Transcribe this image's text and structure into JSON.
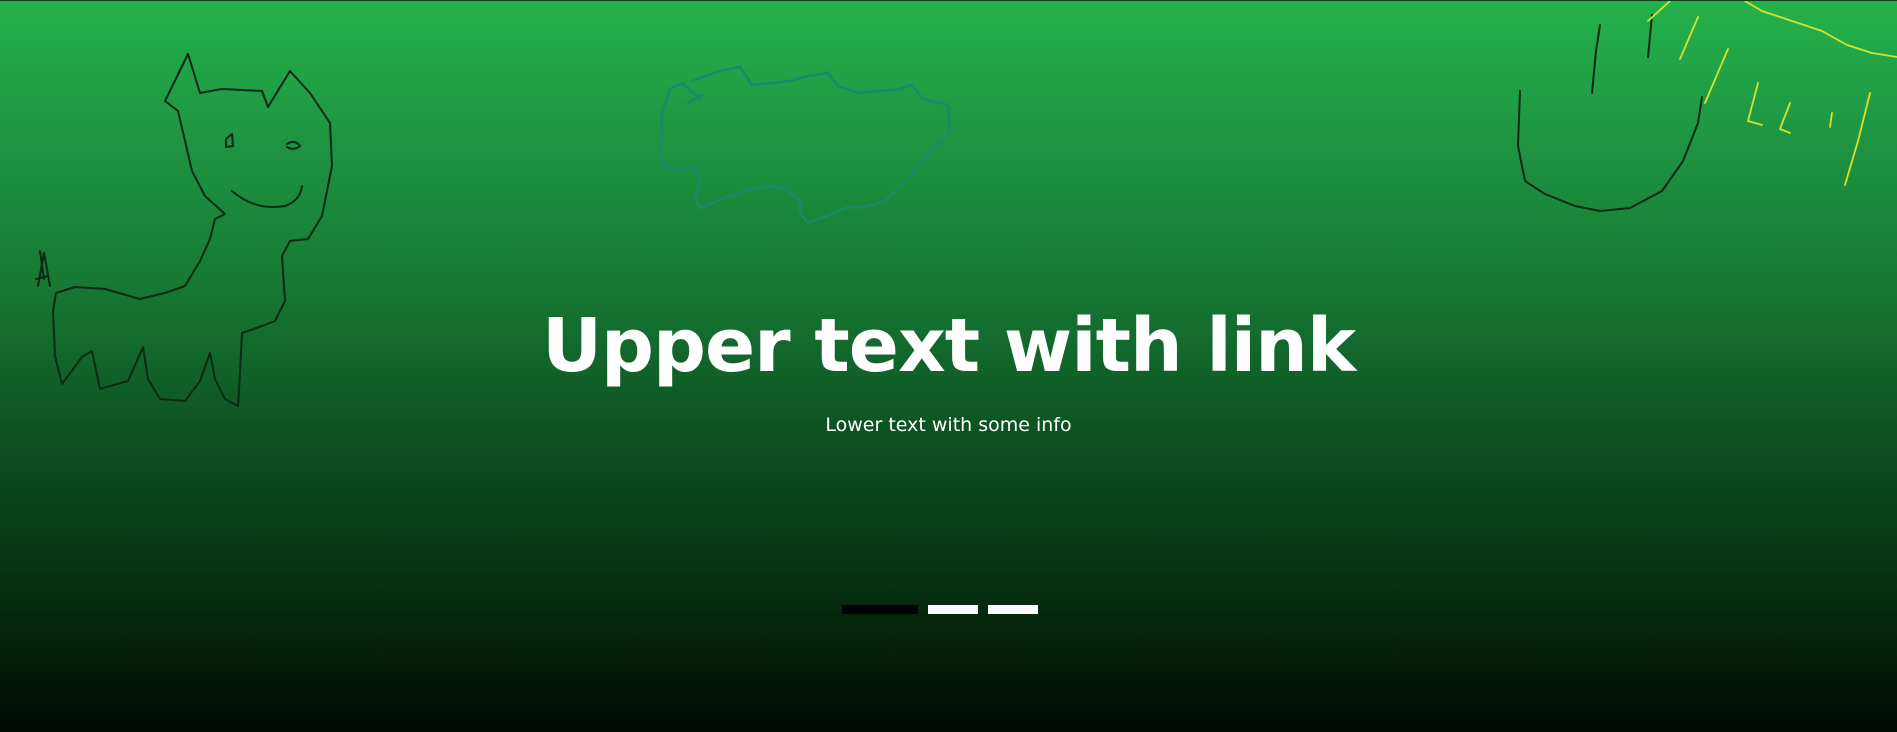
{
  "hero": {
    "title": "Upper text with link",
    "subtitle": "Lower text with some info",
    "colors": {
      "gradient_top": "#24b14c",
      "gradient_bottom": "#020a04",
      "text": "#ffffff"
    }
  },
  "carousel": {
    "slide_count": 3,
    "active_index": 0,
    "indicator_colors": {
      "active": "#000000",
      "inactive": "#ffffff"
    }
  },
  "doodles": [
    {
      "name": "cat-drawing",
      "stroke": "#0b2a14"
    },
    {
      "name": "fish-drawing",
      "stroke": "#1a8a6a"
    },
    {
      "name": "hand-drawing",
      "stroke": "#0b2a14"
    },
    {
      "name": "sun-drawing",
      "stroke": "#d7e22a"
    }
  ]
}
